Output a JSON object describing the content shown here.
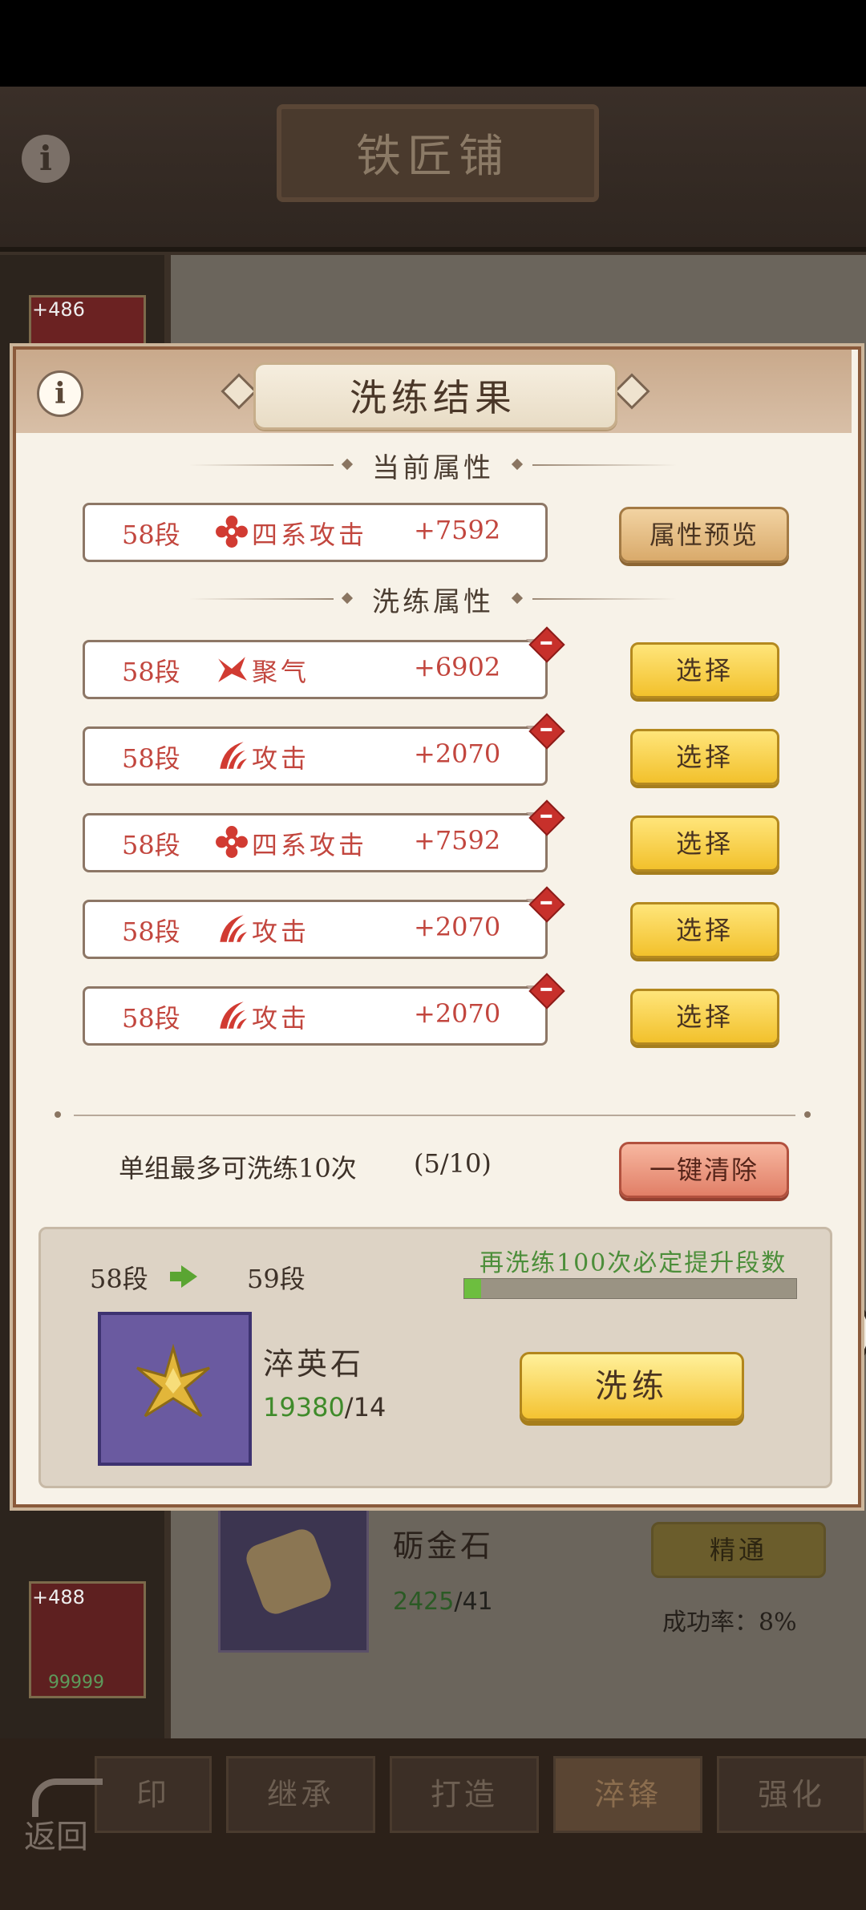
{
  "background": {
    "screen_title": "铁匠铺",
    "card1_level": "+486",
    "card2_level": "+488",
    "card2_value": "99999",
    "item_name": "砺金石",
    "item_have": "2425",
    "item_need": "/41",
    "mastery_label": "精通",
    "success_rate": "成功率：8%",
    "tabs": [
      "印",
      "继承",
      "打造",
      "淬锋",
      "强化"
    ],
    "back_label": "返回"
  },
  "dialog": {
    "title": "洗练结果",
    "current_section": "当前属性",
    "refine_section": "洗练属性",
    "current_attr": {
      "tier": "58段",
      "name": "四系攻击",
      "value": "+7592",
      "icon": "flower-icon"
    },
    "preview_button": "属性预览",
    "results": [
      {
        "tier": "58段",
        "name": "聚气",
        "value": "+6902",
        "icon": "wind-icon",
        "button": "选择"
      },
      {
        "tier": "58段",
        "name": "攻击",
        "value": "+2070",
        "icon": "claw-icon",
        "button": "选择"
      },
      {
        "tier": "58段",
        "name": "四系攻击",
        "value": "+7592",
        "icon": "flower-icon",
        "button": "选择"
      },
      {
        "tier": "58段",
        "name": "攻击",
        "value": "+2070",
        "icon": "claw-icon",
        "button": "选择"
      },
      {
        "tier": "58段",
        "name": "攻击",
        "value": "+2070",
        "icon": "claw-icon",
        "button": "选择"
      }
    ],
    "limit_text": "单组最多可洗练10次",
    "limit_count": "(5/10)",
    "clear_button": "一键清除",
    "tier_from": "58段",
    "tier_to": "59段",
    "promise_text": "再洗练100次必定提升段数",
    "progress": 0.05,
    "stone_name": "淬英石",
    "stone_have": "19380",
    "stone_need": "/14",
    "refine_button": "洗练"
  },
  "colors": {
    "accent_red": "#c2463e",
    "gold": "#f2c12c",
    "green": "#4c8e3a"
  }
}
